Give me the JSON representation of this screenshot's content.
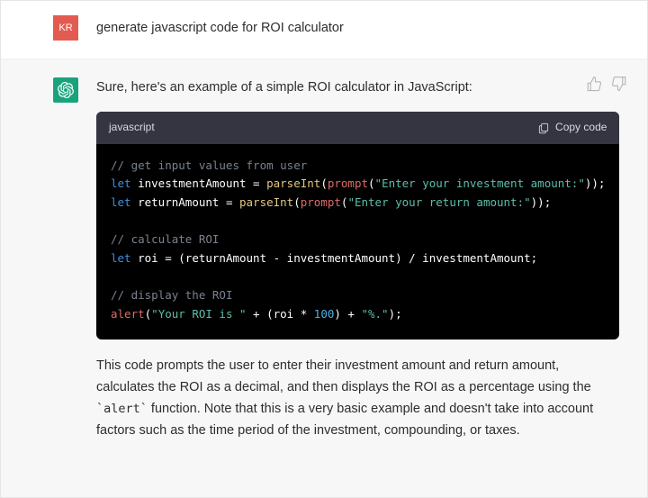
{
  "user": {
    "avatar_initials": "KR",
    "message": "generate javascript code for ROI calculator"
  },
  "assistant": {
    "intro": "Sure, here's an example of a simple ROI calculator in JavaScript:",
    "code_lang": "javascript",
    "copy_label": "Copy code",
    "code": {
      "c1": "// get input values from user",
      "l1_let": "let",
      "l1_var": "investmentAmount",
      "l1_eq": " = ",
      "l1_fn": "parseInt",
      "l1_p1": "(",
      "l1_prompt": "prompt",
      "l1_p2": "(",
      "l1_str": "\"Enter your investment amount:\"",
      "l1_p3": "));",
      "l2_let": "let",
      "l2_var": "returnAmount",
      "l2_eq": " = ",
      "l2_fn": "parseInt",
      "l2_p1": "(",
      "l2_prompt": "prompt",
      "l2_p2": "(",
      "l2_str": "\"Enter your return amount:\"",
      "l2_p3": "));",
      "c2": "// calculate ROI",
      "l3_let": "let",
      "l3_var": "roi",
      "l3_expr": " = (returnAmount - investmentAmount) / investmentAmount;",
      "c3": "// display the ROI",
      "l4_alert": "alert",
      "l4_p1": "(",
      "l4_s1": "\"Your ROI is \"",
      "l4_op1": " + (roi * ",
      "l4_num": "100",
      "l4_op2": ") + ",
      "l4_s2": "\"%.\"",
      "l4_p2": ");"
    },
    "outro_1": "This code prompts the user to enter their investment amount and return amount, calculates the ROI as a decimal, and then displays the ROI as a percentage using the ",
    "outro_code": "`alert`",
    "outro_2": " function. Note that this is a very basic example and doesn't take into account factors such as the time period of the investment, compounding, or taxes."
  }
}
